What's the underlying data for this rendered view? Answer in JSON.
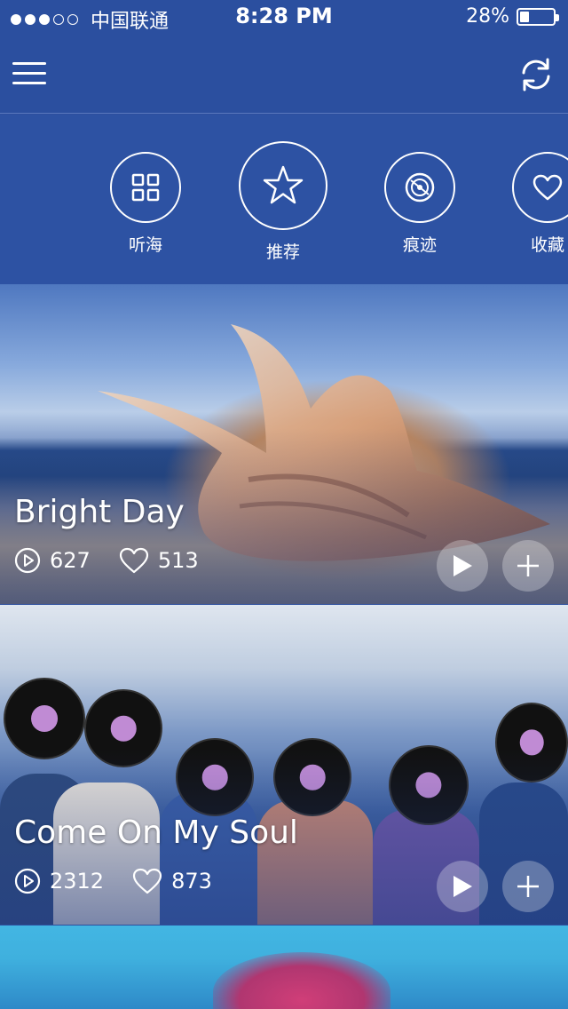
{
  "status_bar": {
    "carrier": "中国联通",
    "time": "8:28 PM",
    "battery": "28%",
    "battery_level": 0.28,
    "signal_strength": 3
  },
  "nav": {
    "menu_icon": "hamburger-icon",
    "refresh_icon": "refresh-icon"
  },
  "tabs": [
    {
      "label": "听海",
      "icon": "grid-icon",
      "selected": false
    },
    {
      "label": "推荐",
      "icon": "star-icon",
      "selected": true
    },
    {
      "label": "痕迹",
      "icon": "vinyl-icon",
      "selected": false
    },
    {
      "label": "收藏",
      "icon": "heart-icon",
      "selected": false
    }
  ],
  "cards": [
    {
      "title": "Bright Day",
      "plays": "627",
      "likes": "513"
    },
    {
      "title": "Come On My Soul",
      "plays": "2312",
      "likes": "873"
    }
  ],
  "colors": {
    "header_blue": "#2b4f9f",
    "tab_bar_blue": "#2d52a3"
  }
}
